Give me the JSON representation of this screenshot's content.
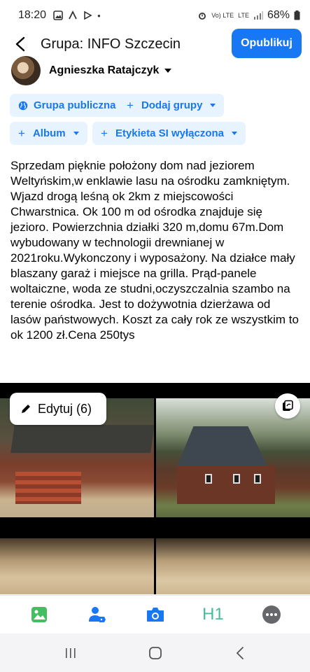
{
  "status_bar": {
    "time": "18:20",
    "network_label_top": "Vo) LTE",
    "network_label_bottom": "LTE",
    "battery": "68%"
  },
  "header": {
    "title": "Grupa: INFO Szczecin",
    "publish_label": "Opublikuj"
  },
  "author": {
    "name": "Agnieszka Ratajczyk"
  },
  "chips": {
    "audience": "Grupa publiczna",
    "add_groups": "Dodaj grupy",
    "album": "Album",
    "ai_label": "Etykieta SI wyłączona"
  },
  "post": {
    "text": "Sprzedam pięknie położony dom nad jeziorem Weltyńskim,w enklawie lasu na ośrodku zamkniętym. Wjazd drogą leśną ok 2km z miejscowości Chwarstnica. Ok 100 m od ośrodka znajduje się jezioro. Powierzchnia działki 320 m,domu 67m.Dom wybudowany w technologii drewnianej w 2021roku.Wykonczony i wyposażony. Na działce mały blaszany garaż i miejsce na grilla. Prąd-panele woltaiczne, woda ze studni,oczyszczalnia szambo na terenie ośrodka. Jest to dożywotnia dzierżawa od lasów państwowych. Koszt za cały rok ze wszystkim to ok 1200 zł.Cena 250tys"
  },
  "photos": {
    "edit_label": "Edytuj (6)"
  },
  "toolbar": {
    "h1_label": "H1"
  },
  "colors": {
    "accent": "#1877f2",
    "chip_bg": "#e7f3ff",
    "photo_icon": "#45bd62",
    "tag_icon": "#1877f2",
    "camera_icon": "#1877f2",
    "h1_color": "#45bd9a",
    "more_icon": "#65676b"
  },
  "icons": {
    "back": "back-arrow-icon",
    "globe": "globe-icon",
    "pencil": "pencil-icon",
    "swap": "swap-icon",
    "photo": "photo-icon",
    "tag_people": "tag-people-icon",
    "camera": "camera-icon",
    "more": "more-icon"
  }
}
